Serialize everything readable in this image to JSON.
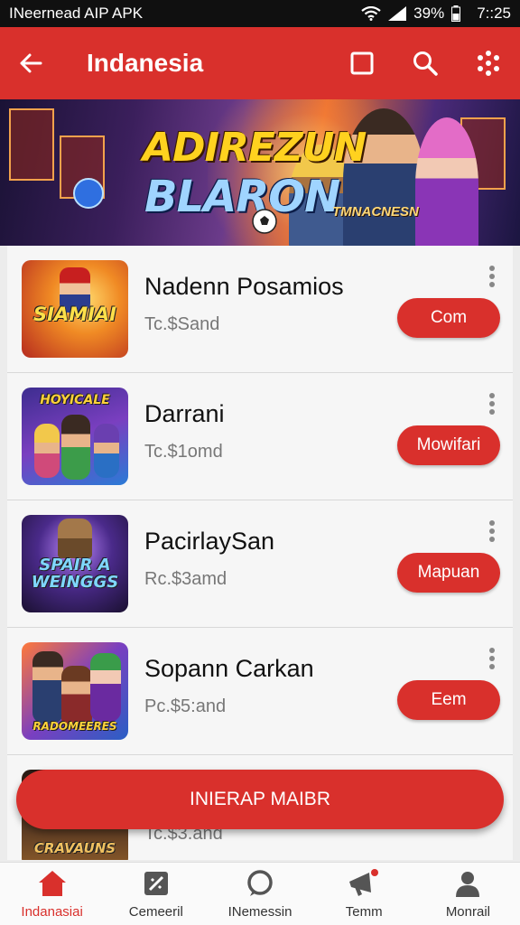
{
  "status_bar": {
    "carrier": "INeernead AIP APK",
    "battery": "39%",
    "time": "7::25"
  },
  "app_bar": {
    "title": "Indanesia",
    "back_icon": "arrow-left-icon",
    "actions": [
      "square-icon",
      "search-icon",
      "dots-grid-icon"
    ]
  },
  "banner": {
    "title_line1": "ADIREZUN",
    "title_line2": "BLARON",
    "subtitle": "TMNACNESN"
  },
  "items": [
    {
      "name": "Nadenn Posamios",
      "price": "Tc.$Sand",
      "button": "Com",
      "thumb_text": "SIAMIAI"
    },
    {
      "name": "Darrani",
      "price": "Tc.$1omd",
      "button": "Mowifari",
      "thumb_text": "HOYICALE"
    },
    {
      "name": "PacirlaySan",
      "price": "Rc.$3amd",
      "button": "Mapuan",
      "thumb_text": "SPAIR A WEINGGS"
    },
    {
      "name": "Sopann Carkan",
      "price": "Pc.$5:and",
      "button": "Eem",
      "thumb_text": "RADOMEERES"
    },
    {
      "name": "",
      "price": "Tc.$3.and",
      "button": "",
      "thumb_text": "CRAVAUNS"
    }
  ],
  "fab": {
    "label": "INIERAP MAIBR"
  },
  "bottom_nav": [
    {
      "label": "Indanasiai",
      "icon": "home-icon",
      "active": true
    },
    {
      "label": "Cemeeril",
      "icon": "puzzle-icon",
      "active": false
    },
    {
      "label": "INemessin",
      "icon": "chat-bubble-icon",
      "active": false
    },
    {
      "label": "Temm",
      "icon": "megaphone-icon",
      "active": false
    },
    {
      "label": "Monrail",
      "icon": "person-icon",
      "active": false
    }
  ],
  "colors": {
    "primary": "#d9302c",
    "background": "#ececec"
  }
}
